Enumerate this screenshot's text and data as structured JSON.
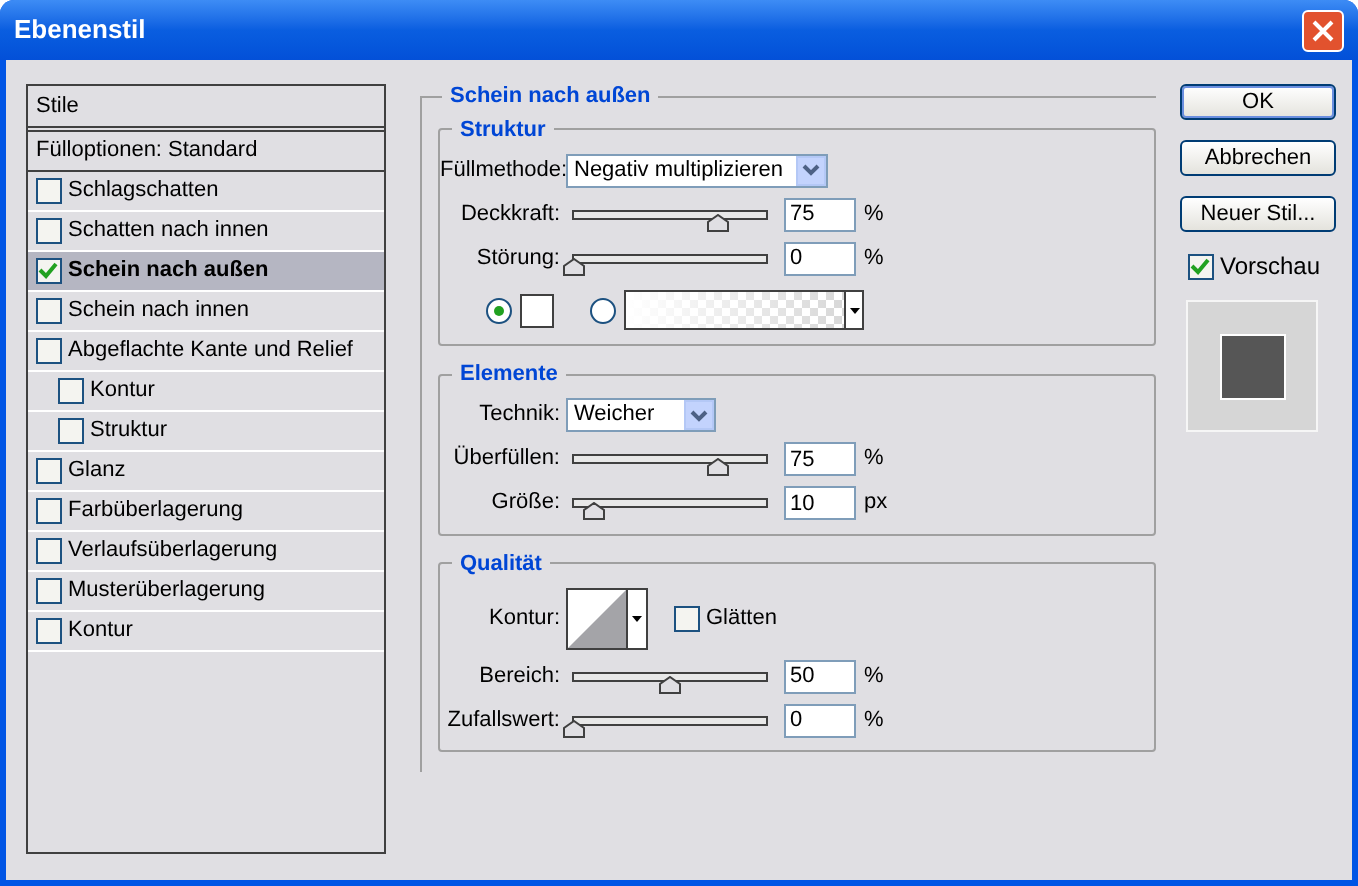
{
  "window": {
    "title": "Ebenenstil"
  },
  "styles_list": {
    "header": "Stile",
    "blend_options": "Fülloptionen: Standard",
    "items": [
      {
        "label": "Schlagschatten",
        "checked": false,
        "selected": false
      },
      {
        "label": "Schatten nach innen",
        "checked": false,
        "selected": false
      },
      {
        "label": "Schein nach außen",
        "checked": true,
        "selected": true
      },
      {
        "label": "Schein nach innen",
        "checked": false,
        "selected": false
      },
      {
        "label": "Abgeflachte Kante und Relief",
        "checked": false,
        "selected": false,
        "children": [
          {
            "label": "Kontur",
            "checked": false,
            "selected": false
          },
          {
            "label": "Struktur",
            "checked": false,
            "selected": false
          }
        ]
      },
      {
        "label": "Glanz",
        "checked": false,
        "selected": false
      },
      {
        "label": "Farbüberlagerung",
        "checked": false,
        "selected": false
      },
      {
        "label": "Verlaufsüberlagerung",
        "checked": false,
        "selected": false
      },
      {
        "label": "Musterüberlagerung",
        "checked": false,
        "selected": false
      },
      {
        "label": "Kontur",
        "checked": false,
        "selected": false
      }
    ]
  },
  "panel": {
    "title": "Schein nach außen",
    "sections": [
      {
        "title": "Struktur",
        "rows": [
          {
            "kind": "select",
            "label": "Füllmethode:",
            "value": "Negativ multiplizieren"
          },
          {
            "kind": "slider",
            "label": "Deckkraft:",
            "level": 0.75,
            "value": "75",
            "unit": "%"
          },
          {
            "kind": "slider",
            "label": "Störung:",
            "level": 0,
            "value": "0",
            "unit": "%"
          },
          {
            "kind": "fill",
            "options": [
              {
                "kind": "color",
                "selected": true
              },
              {
                "kind": "gradient",
                "selected": false
              }
            ]
          }
        ]
      },
      {
        "title": "Elemente",
        "rows": [
          {
            "kind": "select",
            "label": "Technik:",
            "value": "Weicher"
          },
          {
            "kind": "slider",
            "label": "Überfüllen:",
            "level": 0.75,
            "value": "75",
            "unit": "%"
          },
          {
            "kind": "slider",
            "label": "Größe:",
            "level": 0.1,
            "value": "10",
            "unit": "px"
          }
        ]
      },
      {
        "title": "Qualität",
        "rows": [
          {
            "kind": "contour",
            "label": "Kontur:",
            "antialias": {
              "label": "Glätten",
              "checked": false
            }
          },
          {
            "kind": "slider",
            "label": "Bereich:",
            "level": 0.5,
            "value": "50",
            "unit": "%"
          },
          {
            "kind": "slider",
            "label": "Zufallswert:",
            "level": 0,
            "value": "0",
            "unit": "%"
          }
        ]
      }
    ]
  },
  "buttons": [
    {
      "label": "OK",
      "default": true
    },
    {
      "label": "Abbrechen",
      "default": false
    },
    {
      "label": "Neuer Stil...",
      "default": false
    }
  ],
  "preview": {
    "label": "Vorschau",
    "checked": true
  }
}
